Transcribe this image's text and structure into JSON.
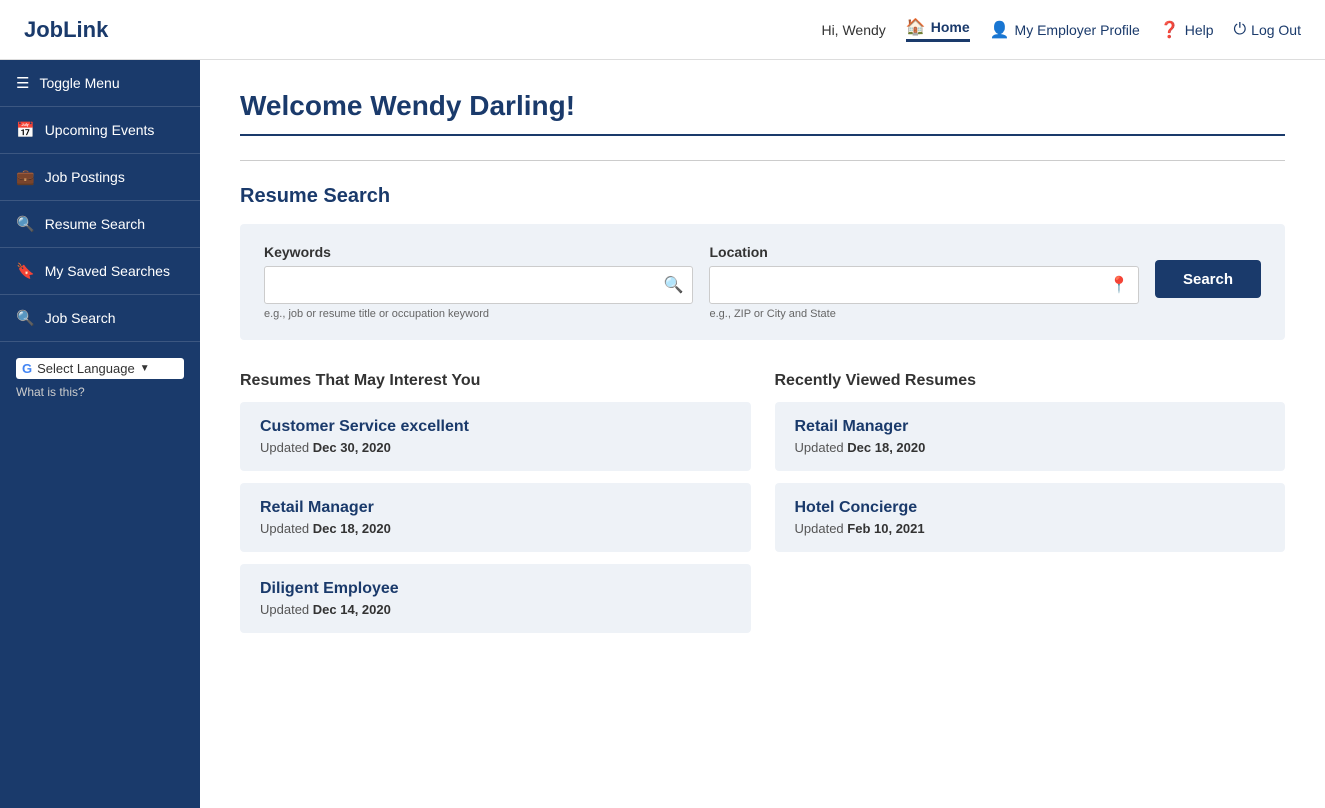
{
  "header": {
    "logo": "JobLink",
    "greeting": "Hi, Wendy",
    "nav": [
      {
        "label": "Home",
        "icon": "🏠",
        "active": true,
        "name": "home-link"
      },
      {
        "label": "My Employer Profile",
        "icon": "👤",
        "active": false,
        "name": "employer-profile-link"
      },
      {
        "label": "Help",
        "icon": "❓",
        "active": false,
        "name": "help-link"
      },
      {
        "label": "Log Out",
        "icon": "⏻",
        "active": false,
        "name": "logout-link"
      }
    ]
  },
  "sidebar": {
    "items": [
      {
        "label": "Toggle Menu",
        "icon": "☰",
        "name": "toggle-menu"
      },
      {
        "label": "Upcoming Events",
        "icon": "📅",
        "name": "upcoming-events"
      },
      {
        "label": "Job Postings",
        "icon": "💼",
        "name": "job-postings"
      },
      {
        "label": "Resume Search",
        "icon": "🔍",
        "name": "resume-search-nav"
      },
      {
        "label": "My Saved Searches",
        "icon": "🔖",
        "name": "my-saved-searches"
      },
      {
        "label": "Job Search",
        "icon": "🔍",
        "name": "job-search"
      }
    ],
    "language": {
      "label": "Select Language",
      "what_is_this": "What is this?"
    }
  },
  "main": {
    "page_title": "Welcome Wendy Darling!",
    "resume_search": {
      "section_title": "Resume Search",
      "keywords_label": "Keywords",
      "keywords_placeholder": "",
      "keywords_hint": "e.g., job or resume title or occupation keyword",
      "location_label": "Location",
      "location_placeholder": "",
      "location_hint": "e.g., ZIP or City and State",
      "search_button": "Search"
    },
    "resumes_interest": {
      "col_title": "Resumes That May Interest You",
      "cards": [
        {
          "title": "Customer Service excellent",
          "updated_label": "Updated",
          "updated_date": "Dec 30, 2020"
        },
        {
          "title": "Retail Manager",
          "updated_label": "Updated",
          "updated_date": "Dec 18, 2020"
        },
        {
          "title": "Diligent Employee",
          "updated_label": "Updated",
          "updated_date": "Dec 14, 2020"
        }
      ]
    },
    "recently_viewed": {
      "col_title": "Recently Viewed Resumes",
      "cards": [
        {
          "title": "Retail Manager",
          "updated_label": "Updated",
          "updated_date": "Dec 18, 2020"
        },
        {
          "title": "Hotel Concierge",
          "updated_label": "Updated",
          "updated_date": "Feb 10, 2021"
        }
      ]
    }
  }
}
